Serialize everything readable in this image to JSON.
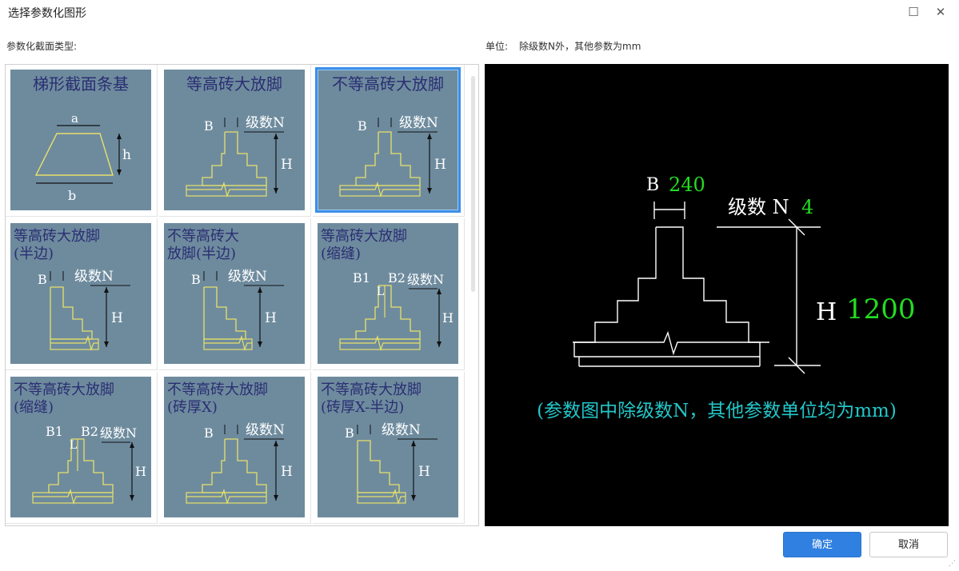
{
  "window": {
    "title": "选择参数化图形",
    "maximize_glyph": "☐",
    "close_glyph": "✕"
  },
  "left_panel": {
    "label": "参数化截面类型:"
  },
  "unit_info": {
    "label": "单位:",
    "text": "除级数N外，其他参数为mm"
  },
  "shapes": [
    {
      "title": "梯形截面条基",
      "kind": "trap",
      "dims": [
        "a",
        "h",
        "b"
      ]
    },
    {
      "title": "等高砖大放脚",
      "kind": "sym",
      "dims": [
        "B",
        "级数N",
        "H"
      ]
    },
    {
      "title": "不等高砖大放脚",
      "kind": "sym",
      "dims": [
        "B",
        "级数N",
        "H"
      ],
      "selected": true
    },
    {
      "title": "等高砖大放脚\n(半边)",
      "kind": "half",
      "dims": [
        "B",
        "级数N",
        "H"
      ]
    },
    {
      "title": "不等高砖大\n放脚(半边)",
      "kind": "half",
      "dims": [
        "B",
        "级数N",
        "H"
      ]
    },
    {
      "title": "等高砖大放脚\n(缩缝)",
      "kind": "gap",
      "dims": [
        "B1",
        "L",
        "B2",
        "级数N",
        "H"
      ]
    },
    {
      "title": "不等高砖大放脚\n(缩缝)",
      "kind": "gap",
      "dims": [
        "B1",
        "L",
        "B2",
        "级数N",
        "H"
      ]
    },
    {
      "title": "不等高砖大放脚\n(砖厚X)",
      "kind": "sym",
      "dims": [
        "B",
        "级数N",
        "H"
      ]
    },
    {
      "title": "不等高砖大放脚\n(砖厚X-半边)",
      "kind": "half",
      "dims": [
        "B",
        "级数N",
        "H"
      ]
    }
  ],
  "preview": {
    "b_label": "B",
    "b_value": "240",
    "n_label": "级数 N",
    "n_value": "4",
    "h_label": "H",
    "h_value": "1200",
    "note": "(参数图中除级数N，其他参数单位均为mm)",
    "colors": {
      "value": "#22dd22",
      "note": "#23c7c9",
      "line": "#ffffff"
    }
  },
  "buttons": {
    "ok": "确定",
    "cancel": "取消"
  }
}
